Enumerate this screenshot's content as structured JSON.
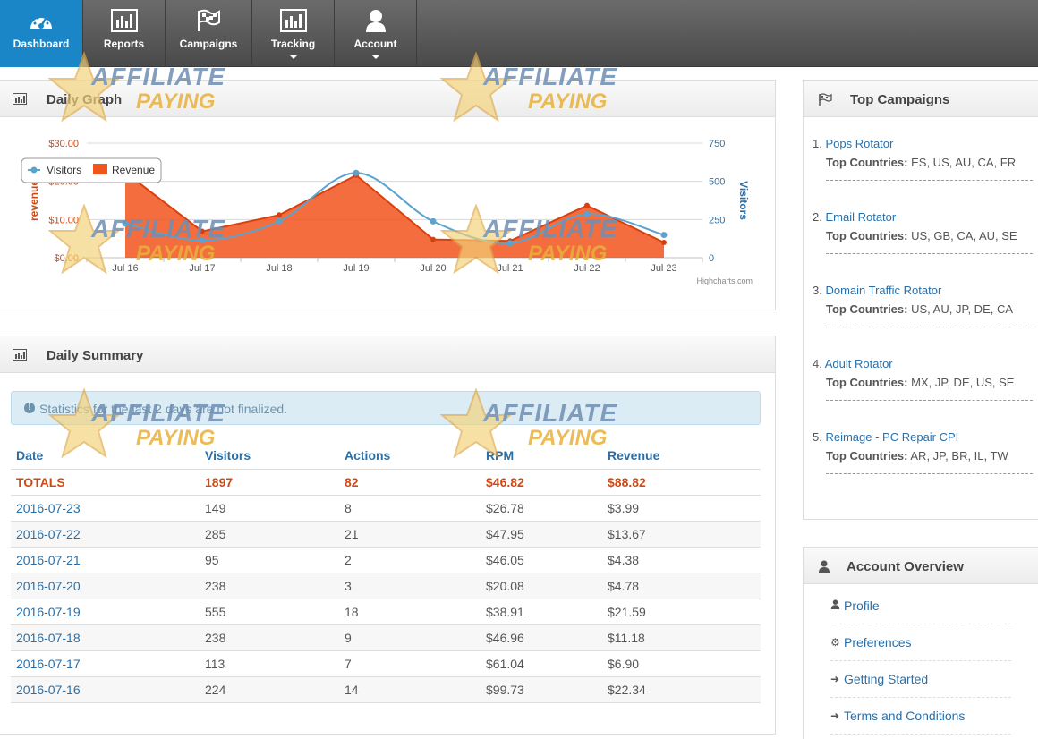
{
  "nav": {
    "items": [
      {
        "label": "Dashboard",
        "icon": "dashboard-icon",
        "active": true,
        "dropdown": false
      },
      {
        "label": "Reports",
        "icon": "bar-chart-icon",
        "active": false,
        "dropdown": false
      },
      {
        "label": "Campaigns",
        "icon": "flag-icon",
        "active": false,
        "dropdown": false
      },
      {
        "label": "Tracking",
        "icon": "bar-chart-icon",
        "active": false,
        "dropdown": true
      },
      {
        "label": "Account",
        "icon": "user-icon",
        "active": false,
        "dropdown": true
      }
    ]
  },
  "daily_graph": {
    "title": "Daily Graph",
    "credit": "Highcharts.com",
    "legend": [
      "Visitors",
      "Revenue"
    ]
  },
  "chart_data": {
    "type": "line",
    "categories": [
      "Jul 16",
      "Jul 17",
      "Jul 18",
      "Jul 19",
      "Jul 20",
      "Jul 21",
      "Jul 22",
      "Jul 23"
    ],
    "series": [
      {
        "name": "Visitors",
        "axis": "right",
        "values": [
          224,
          113,
          238,
          555,
          238,
          95,
          285,
          149
        ],
        "color": "#5ba3cf"
      },
      {
        "name": "Revenue",
        "axis": "left",
        "values": [
          22.34,
          6.9,
          11.18,
          21.59,
          4.78,
          4.38,
          13.67,
          3.99
        ],
        "color": "#f2541c"
      }
    ],
    "ylabel_left": "revenue",
    "ylabel_right": "Visitors",
    "yticks_left": [
      "$0.00",
      "$10.00",
      "$20.00",
      "$30.00"
    ],
    "yticks_right": [
      "0",
      "250",
      "500",
      "750"
    ],
    "ylim_left": [
      0,
      30
    ],
    "ylim_right": [
      0,
      750
    ],
    "legend_position": "top-left"
  },
  "daily_summary": {
    "title": "Daily Summary",
    "notice": "Statistics for the last 2 days are not finalized.",
    "columns": [
      "Date",
      "Visitors",
      "Actions",
      "RPM",
      "Revenue"
    ],
    "totals": [
      "TOTALS",
      "1897",
      "82",
      "$46.82",
      "$88.82"
    ],
    "rows": [
      [
        "2016-07-23",
        "149",
        "8",
        "$26.78",
        "$3.99"
      ],
      [
        "2016-07-22",
        "285",
        "21",
        "$47.95",
        "$13.67"
      ],
      [
        "2016-07-21",
        "95",
        "2",
        "$46.05",
        "$4.38"
      ],
      [
        "2016-07-20",
        "238",
        "3",
        "$20.08",
        "$4.78"
      ],
      [
        "2016-07-19",
        "555",
        "18",
        "$38.91",
        "$21.59"
      ],
      [
        "2016-07-18",
        "238",
        "9",
        "$46.96",
        "$11.18"
      ],
      [
        "2016-07-17",
        "113",
        "7",
        "$61.04",
        "$6.90"
      ],
      [
        "2016-07-16",
        "224",
        "14",
        "$99.73",
        "$22.34"
      ]
    ]
  },
  "top_campaigns": {
    "title": "Top Campaigns",
    "countries_label": "Top Countries:",
    "items": [
      {
        "num": "1.",
        "name": "Pops Rotator",
        "countries": "ES, US, AU, CA, FR"
      },
      {
        "num": "2.",
        "name": "Email Rotator",
        "countries": "US, GB, CA, AU, SE"
      },
      {
        "num": "3.",
        "name": "Domain Traffic Rotator",
        "countries": "US, AU, JP, DE, CA"
      },
      {
        "num": "4.",
        "name": "Adult Rotator",
        "countries": "MX, JP, DE, US, SE"
      },
      {
        "num": "5.",
        "name": "Reimage - PC Repair CPI",
        "countries": "AR, JP, BR, IL, TW"
      }
    ]
  },
  "account_overview": {
    "title": "Account Overview",
    "links": [
      {
        "label": "Profile",
        "icon": "user-icon"
      },
      {
        "label": "Preferences",
        "icon": "gear-icon"
      },
      {
        "label": "Getting Started",
        "icon": "sign-in-icon"
      },
      {
        "label": "Terms and Conditions",
        "icon": "sign-in-icon"
      }
    ]
  },
  "watermark": {
    "line1": "AFFILIATE",
    "line2": "PAYING"
  },
  "colors": {
    "accent": "#1a86c8",
    "link": "#2a6fa8",
    "revenue": "#f2541c",
    "visitors": "#5ba3cf",
    "totals": "#cc4a16"
  }
}
